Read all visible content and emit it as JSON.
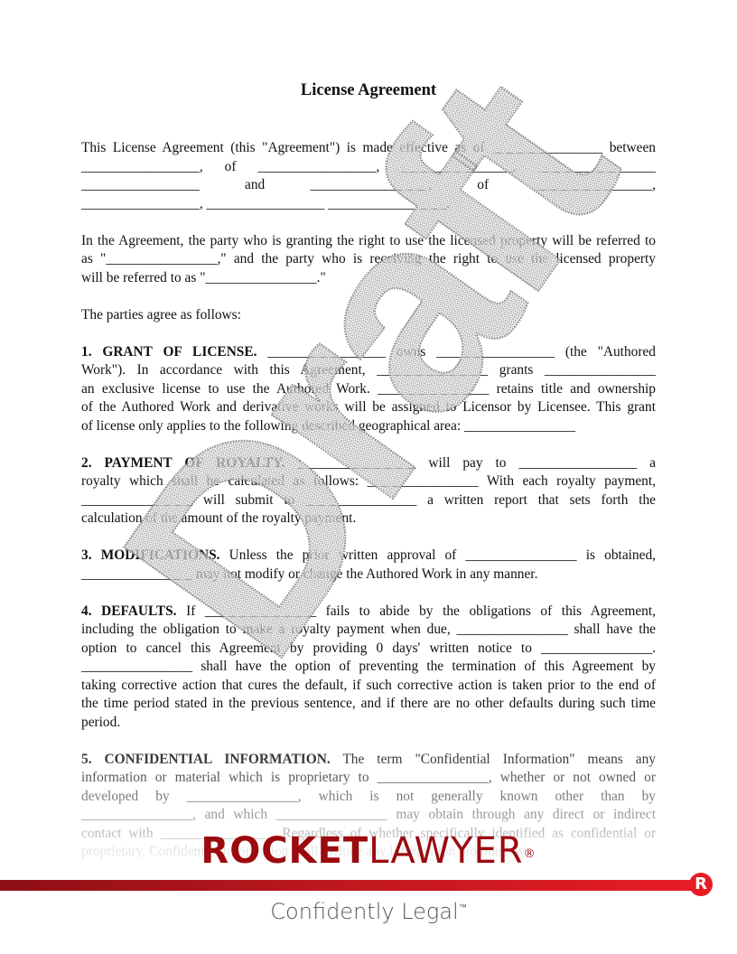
{
  "document": {
    "title": "License Agreement",
    "paragraphs": [
      {
        "lines": [
          "This License Agreement (this \"Agreement\") is made effective as of ________________ between",
          "_________________, of _________________, ________________, _________________",
          "_________________ and _________________, of _________________,",
          "_________________, _________________ _________________."
        ]
      },
      {
        "lines": [
          "In the Agreement, the party who is granting the right to use the licensed property will be referred to",
          "as \"________________,\" and the party who is receiving the right to use the licensed property",
          "will be referred to as \"________________.\""
        ]
      },
      {
        "lines": [
          "The parties agree as follows:"
        ]
      }
    ],
    "sections": [
      {
        "heading": "1. GRANT OF LICENSE.",
        "lines": [
          " _________________ owns _________________ (the \"Authored",
          "Work\"). In accordance with this Agreement, ________________ grants ________________",
          "an exclusive license to use the Authored Work. ________________ retains title and ownership",
          "of the Authored Work and derivative works will be assigned to Licensor by Licensee. This grant",
          "of license only applies to the following described geographical area: ________________"
        ]
      },
      {
        "heading": "2. PAYMENT OF ROYALTY.",
        "lines": [
          " _________________ will pay to _________________ a",
          "royalty which shall be calculated as follows: ________________ With each royalty payment,",
          "________________ will submit to ________________ a written report that sets forth the",
          "calculation of the amount of the royalty payment."
        ]
      },
      {
        "heading": "3. MODIFICATIONS.",
        "lines": [
          " Unless the prior written approval of ________________ is obtained,",
          "________________ may not modify or change the Authored Work in any manner."
        ]
      },
      {
        "heading": "4. DEFAULTS.",
        "lines": [
          " If ________________ fails to abide by the obligations of this Agreement,",
          "including the obligation to make a royalty payment when due, ________________ shall have the",
          "option to cancel this Agreement by providing 0 days' written notice to ________________.",
          "________________ shall have the option of preventing the termination of this Agreement by",
          "taking corrective action that cures the default, if such corrective action is taken prior to the end of",
          "the time period stated in the previous sentence, and if there are no other defaults during such time",
          "period."
        ]
      },
      {
        "heading": "5. CONFIDENTIAL INFORMATION.",
        "lines": [
          " The term \"Confidential Information\" means any",
          "information or material which is proprietary to ________________, whether or not owned or",
          "developed by ________________, which is not generally known other than by",
          "________________, and which ________________ may obtain through any direct or indirect",
          "contact with ________________. Regardless of whether specifically identified as confidential or",
          "proprietary, Confidential Information shall include any information provided by"
        ]
      }
    ]
  },
  "watermark": {
    "text": "Draft"
  },
  "branding": {
    "logo_bold": "ROCKET",
    "logo_light": "LAWYER",
    "logo_reg": "®",
    "badge_letter": "R",
    "tagline": "Confidently Legal",
    "tagline_tm": "™",
    "brand_color": "#9b0a0e",
    "bar_color": "#e81c24"
  }
}
